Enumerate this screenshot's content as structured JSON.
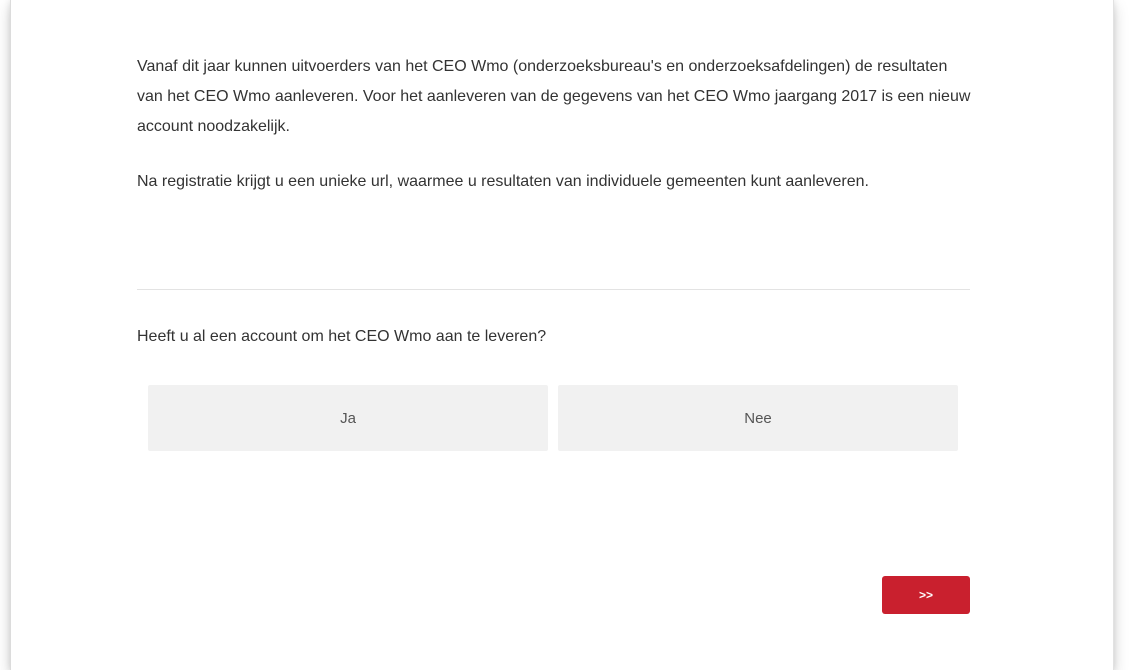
{
  "intro": {
    "paragraph1": "Vanaf dit jaar kunnen uitvoerders van het CEO Wmo (onderzoeksbureau's en onderzoeksafdelingen) de resultaten van het CEO Wmo aanleveren. Voor het aanleveren van de gegevens van het CEO Wmo jaargang 2017 is een nieuw account noodzakelijk.",
    "paragraph2": "Na registratie krijgt u een unieke url, waarmee u resultaten van individuele gemeenten kunt aanleveren."
  },
  "question": {
    "text": "Heeft u al een account om het CEO Wmo aan te leveren?",
    "options": [
      {
        "label": "Ja"
      },
      {
        "label": "Nee"
      }
    ]
  },
  "navigation": {
    "next_label": ">>"
  },
  "colors": {
    "accent": "#c9202e",
    "option_background": "#f1f1f1",
    "text": "#333333"
  }
}
